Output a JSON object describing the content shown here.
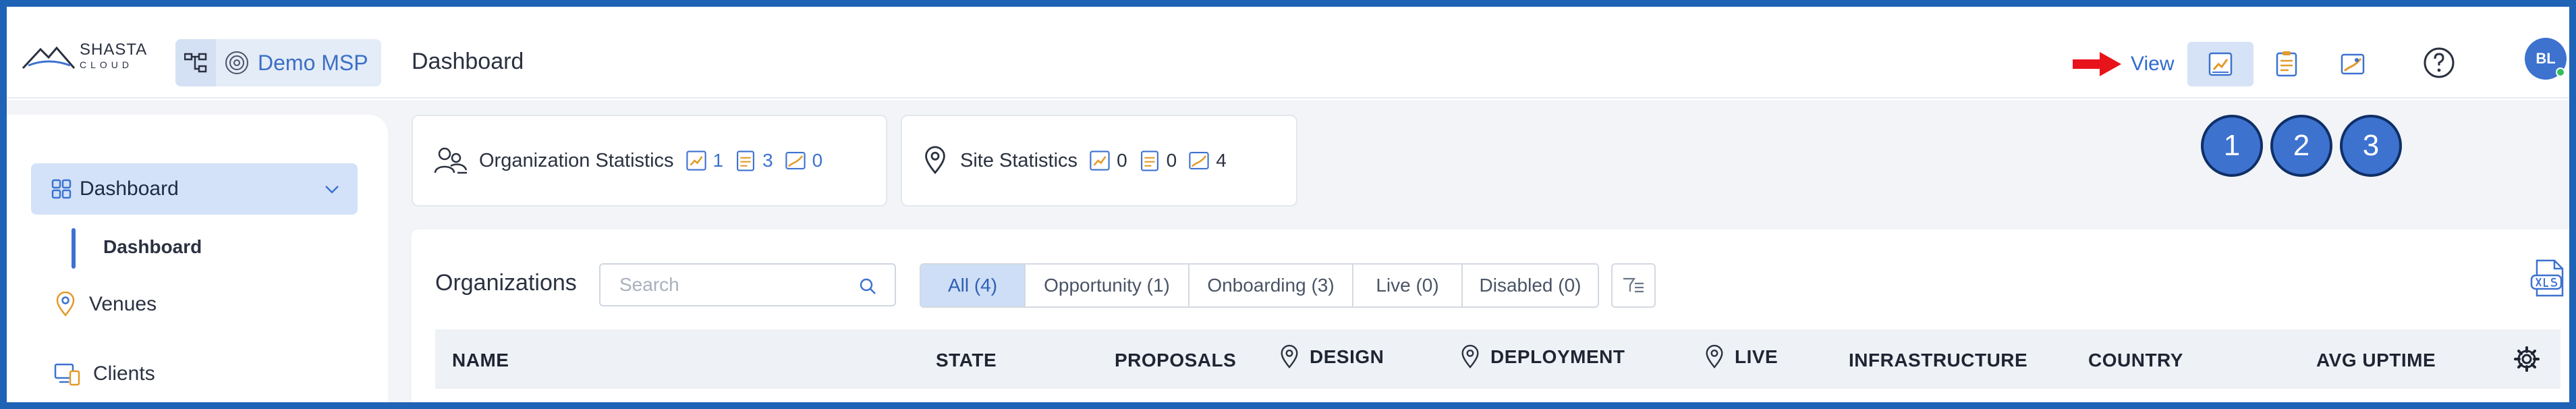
{
  "header": {
    "logo_line1": "SHASTA",
    "logo_line2": "CLOUD",
    "msp_name": "Demo MSP",
    "page_title": "Dashboard",
    "view_label": "View",
    "avatar_initials": "BL",
    "view_buttons": [
      {
        "icon": "dashboard-chart-icon",
        "active": true
      },
      {
        "icon": "checklist-report-icon",
        "active": false
      },
      {
        "icon": "map-icon",
        "active": false
      }
    ],
    "callouts": [
      "1",
      "2",
      "3"
    ]
  },
  "sidebar": {
    "items": [
      {
        "label": "Dashboard",
        "icon": "grid-icon",
        "expanded": true,
        "children": [
          {
            "label": "Dashboard"
          }
        ]
      },
      {
        "label": "Venues",
        "icon": "location-pin-icon"
      },
      {
        "label": "Clients",
        "icon": "devices-icon"
      }
    ]
  },
  "stats": {
    "org": {
      "label": "Organization Statistics",
      "design": "1",
      "deployment": "3",
      "live": "0"
    },
    "site": {
      "label": "Site Statistics",
      "design": "0",
      "deployment": "0",
      "live": "4"
    }
  },
  "organizations": {
    "title": "Organizations",
    "search_placeholder": "Search",
    "tabs": [
      {
        "label": "All (4)",
        "active": true
      },
      {
        "label": "Opportunity (1)"
      },
      {
        "label": "Onboarding (3)"
      },
      {
        "label": "Live (0)"
      },
      {
        "label": "Disabled (0)"
      }
    ],
    "columns": [
      "NAME",
      "STATE",
      "PROPOSALS",
      "DESIGN",
      "DEPLOYMENT",
      "LIVE",
      "INFRASTRUCTURE",
      "COUNTRY",
      "AVG UPTIME"
    ]
  },
  "colors": {
    "accent": "#3d72cf",
    "frame": "#1f63b6",
    "active_bg": "#d3e2f8",
    "arrow": "#e8141b",
    "online": "#2fbf5a"
  }
}
